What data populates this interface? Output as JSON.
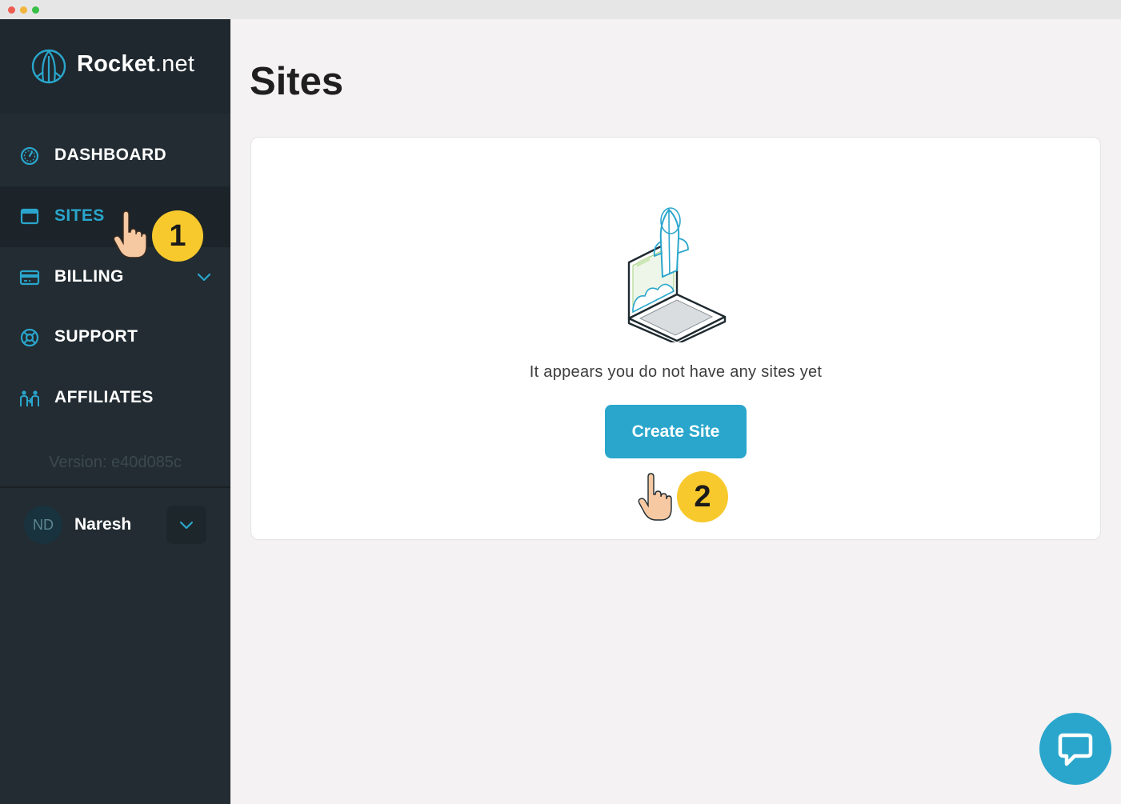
{
  "brand": {
    "name_bold": "Rocket",
    "name_tld": ".net",
    "logo_icon": "rocket-logo-icon",
    "accent_color": "#2aa6cc"
  },
  "sidebar": {
    "items": [
      {
        "label": "DASHBOARD",
        "icon": "dashboard-gauge-icon",
        "active": false
      },
      {
        "label": "SITES",
        "icon": "browser-window-icon",
        "active": true
      },
      {
        "label": "BILLING",
        "icon": "credit-card-icon",
        "active": false,
        "expandable": true
      },
      {
        "label": "SUPPORT",
        "icon": "lifebuoy-icon",
        "active": false
      },
      {
        "label": "AFFILIATES",
        "icon": "people-icon",
        "active": false
      }
    ],
    "version": "Version: e40d085c",
    "user": {
      "initials": "ND",
      "name": "Naresh"
    }
  },
  "main": {
    "title": "Sites",
    "empty_state": {
      "illustration": "laptop-rocket-illustration",
      "message": "It appears you do not have any sites yet",
      "button_label": "Create Site"
    }
  },
  "annotations": {
    "step1": "1",
    "step2": "2",
    "badge_color": "#f7c92c"
  },
  "chat": {
    "icon": "chat-bubble-icon"
  }
}
